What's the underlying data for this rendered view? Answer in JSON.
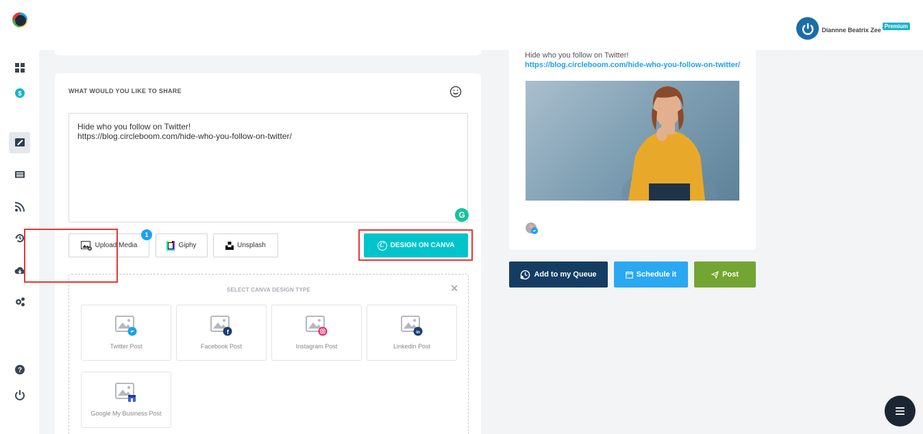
{
  "user": {
    "name": "Diannne Beatrix Zee",
    "plan": "Premium"
  },
  "compose": {
    "title": "WHAT WOULD YOU LIKE TO SHARE",
    "text_line1": "Hide who you follow on Twitter!",
    "text_line2": "https://blog.circleboom.com/hide-who-you-follow-on-twitter/",
    "upload_media": "Upload Media",
    "upload_badge": "1",
    "giphy": "Giphy",
    "unsplash": "Unsplash",
    "design_on_canva": "DESIGN ON CANVA"
  },
  "canva_types": {
    "title": "SELECT CANVA DESIGN TYPE",
    "items": [
      {
        "label": "Twitter Post",
        "icon": "twitter-icon"
      },
      {
        "label": "Facebook Post",
        "icon": "facebook-icon"
      },
      {
        "label": "Instagram Post",
        "icon": "instagram-icon"
      },
      {
        "label": "Linkedin Post",
        "icon": "linkedin-icon"
      },
      {
        "label": "Google My Business Post",
        "icon": "google-my-business-icon"
      }
    ]
  },
  "preview": {
    "text": "Hide who you follow on Twitter!",
    "link": "https://blog.circleboom.com/hide-who-you-follow-on-twitter/"
  },
  "actions": {
    "queue": "Add to my Queue",
    "schedule": "Schedule it",
    "post": "Post"
  },
  "colors": {
    "queue": "#153d63",
    "schedule": "#2aa8f2",
    "post": "#73a532",
    "canva": "#00c4cc",
    "highlight": "#e53935"
  }
}
